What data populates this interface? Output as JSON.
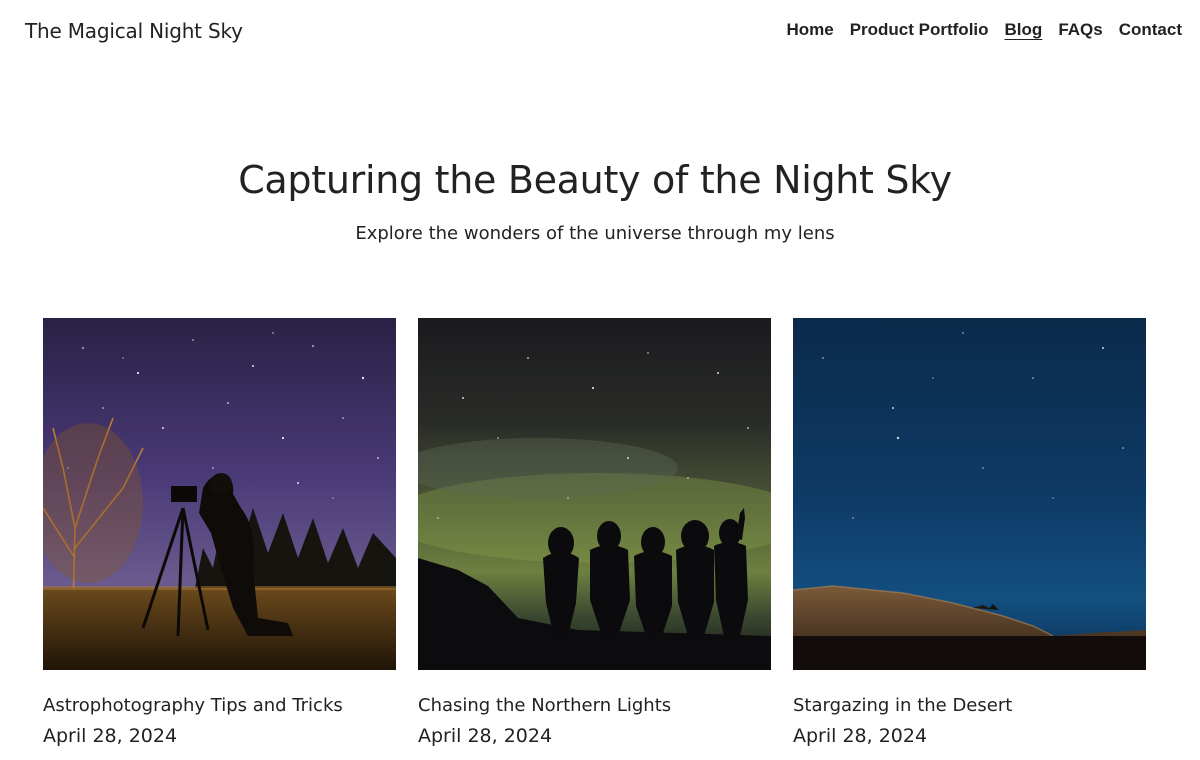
{
  "site": {
    "title": "The Magical Night Sky"
  },
  "nav": {
    "items": [
      {
        "label": "Home",
        "active": false
      },
      {
        "label": "Product Portfolio",
        "active": false
      },
      {
        "label": "Blog",
        "active": true
      },
      {
        "label": "FAQs",
        "active": false
      },
      {
        "label": "Contact",
        "active": false
      }
    ]
  },
  "hero": {
    "title": "Capturing the Beauty of the Night Sky",
    "subtitle": "Explore the wonders of the universe through my lens"
  },
  "posts": [
    {
      "title": "Astrophotography Tips and Tricks",
      "date": "April 28, 2024",
      "image": "photographer-with-tripod-under-starry-sky"
    },
    {
      "title": "Chasing the Northern Lights",
      "date": "April 28, 2024",
      "image": "group-silhouettes-under-aurora"
    },
    {
      "title": "Stargazing in the Desert",
      "date": "April 28, 2024",
      "image": "desert-ridge-under-blue-night-sky"
    }
  ]
}
